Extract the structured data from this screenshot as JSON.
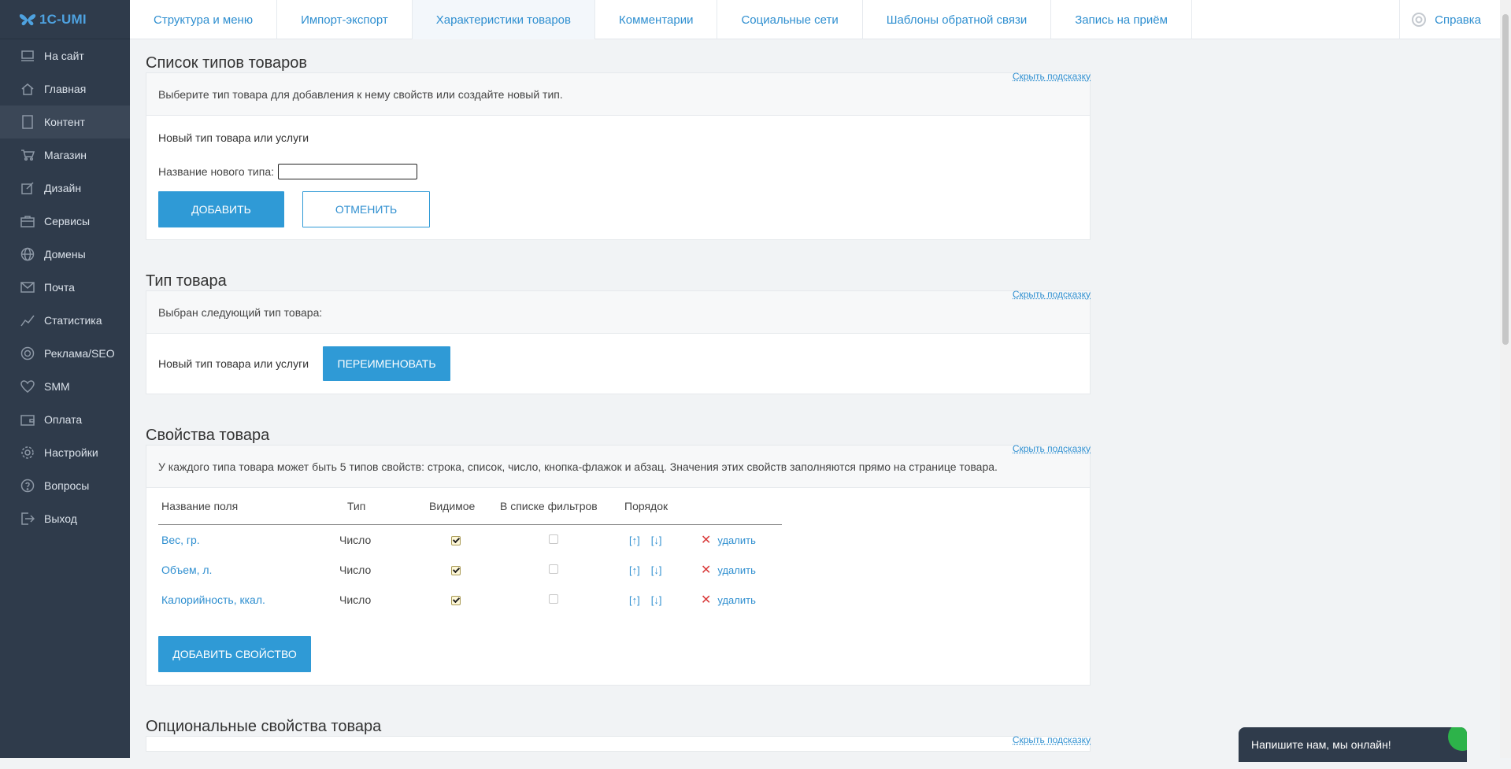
{
  "logo": {
    "text": "1C-UMI"
  },
  "sidebar": {
    "items": [
      {
        "label": "На сайт",
        "icon": "monitor-icon"
      },
      {
        "label": "Главная",
        "icon": "home-icon"
      },
      {
        "label": "Контент",
        "icon": "document-icon",
        "active": true
      },
      {
        "label": "Магазин",
        "icon": "cart-icon"
      },
      {
        "label": "Дизайн",
        "icon": "brush-icon"
      },
      {
        "label": "Сервисы",
        "icon": "briefcase-icon"
      },
      {
        "label": "Домены",
        "icon": "globe-icon"
      },
      {
        "label": "Почта",
        "icon": "mail-icon"
      },
      {
        "label": "Статистика",
        "icon": "chart-icon"
      },
      {
        "label": "Реклама/SEO",
        "icon": "target-icon"
      },
      {
        "label": "SMM",
        "icon": "heart-icon"
      },
      {
        "label": "Оплата",
        "icon": "wallet-icon"
      },
      {
        "label": "Настройки",
        "icon": "gear-icon"
      },
      {
        "label": "Вопросы",
        "icon": "question-icon"
      },
      {
        "label": "Выход",
        "icon": "logout-icon"
      }
    ]
  },
  "tabs": [
    {
      "label": "Структура и меню"
    },
    {
      "label": "Импорт-экспорт"
    },
    {
      "label": "Характеристики товаров",
      "active": true
    },
    {
      "label": "Комментарии"
    },
    {
      "label": "Социальные сети"
    },
    {
      "label": "Шаблоны обратной связи"
    },
    {
      "label": "Запись на приём"
    }
  ],
  "help": {
    "label": "Справка"
  },
  "sections": {
    "types_list": {
      "title": "Список типов товаров",
      "hint_link": "Скрыть подсказку",
      "hint": "Выберите тип товара для добавления к нему свойств или создайте новый тип.",
      "subheading": "Новый тип товара или услуги",
      "name_label": "Название нового типа:",
      "name_value": "",
      "add_button": "ДОБАВИТЬ",
      "cancel_button": "ОТМЕНИТЬ"
    },
    "product_type": {
      "title": "Тип товара",
      "hint_link": "Скрыть подсказку",
      "hint": "Выбран следующий тип товара:",
      "type_name": "Новый тип товара или услуги",
      "rename_button": "ПЕРЕИМЕНОВАТЬ"
    },
    "properties": {
      "title": "Свойства товара",
      "hint_link": "Скрыть подсказку",
      "hint": "У каждого типа товара может быть 5 типов свойств: строка, список, число, кнопка-флажок и абзац. Значения этих свойств заполняются прямо на странице товара.",
      "columns": [
        "Название поля",
        "Тип",
        "Видимое",
        "В списке фильтров",
        "Порядок"
      ],
      "rows": [
        {
          "name": "Вес, гр.",
          "type": "Число",
          "visible": true,
          "in_filters": false
        },
        {
          "name": "Объем, л.",
          "type": "Число",
          "visible": true,
          "in_filters": false
        },
        {
          "name": "Калорийность, ккал.",
          "type": "Число",
          "visible": true,
          "in_filters": false
        }
      ],
      "order_up": "[↑]",
      "order_down": "[↓]",
      "delete_label": "удалить",
      "add_button": "ДОБАВИТЬ СВОЙСТВО"
    },
    "optional": {
      "title": "Опциональные свойства товара",
      "hint_link": "Скрыть подсказку"
    }
  },
  "chat": {
    "label": "Напишите нам, мы онлайн!"
  },
  "colors": {
    "sidebar_bg": "#2f3b4b",
    "accent": "#2f9ad6",
    "link": "#2f8fd0",
    "delete": "#d93a3a",
    "chat_dot": "#2db34a"
  }
}
